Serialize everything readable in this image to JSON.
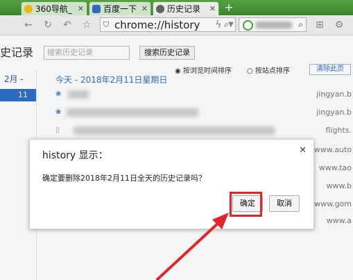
{
  "tabs": [
    {
      "label": "360导航_",
      "close": "✕"
    },
    {
      "label": "百度一下",
      "close": "✕"
    },
    {
      "label": "历史记录",
      "close": "✕"
    }
  ],
  "newtab": "+",
  "toolbar": {
    "url": "chrome://history",
    "search_icon": "search-icon"
  },
  "page": {
    "title": "史记录",
    "search_placeholder": "搜索历史记录",
    "search_button": "搜索历史记录",
    "month": "2月 -",
    "day": "11",
    "sort_time": "按浏览时间排序",
    "sort_site": "按站点排序",
    "delete_button": "清除此页",
    "day_header": "今天 - 2018年2月11日星期日"
  },
  "history_rows": [
    {
      "domain": "jingyan.b"
    },
    {
      "domain": "jingyan.b"
    },
    {
      "domain": "flights."
    },
    {
      "domain": "www.auto"
    },
    {
      "domain": "www.tao"
    },
    {
      "domain": "www.b"
    },
    {
      "domain": "www.gom"
    },
    {
      "domain": "www.a"
    }
  ],
  "dialog": {
    "title": "history 显示：",
    "message": "确定要删除2018年2月11日全天的历史记录吗？",
    "confirm": "确定",
    "cancel": "取消",
    "close": "✕"
  },
  "colors": {
    "accent": "#2f72c8",
    "tabbar": "#4e9a3b",
    "highlight": "#e0262b"
  }
}
